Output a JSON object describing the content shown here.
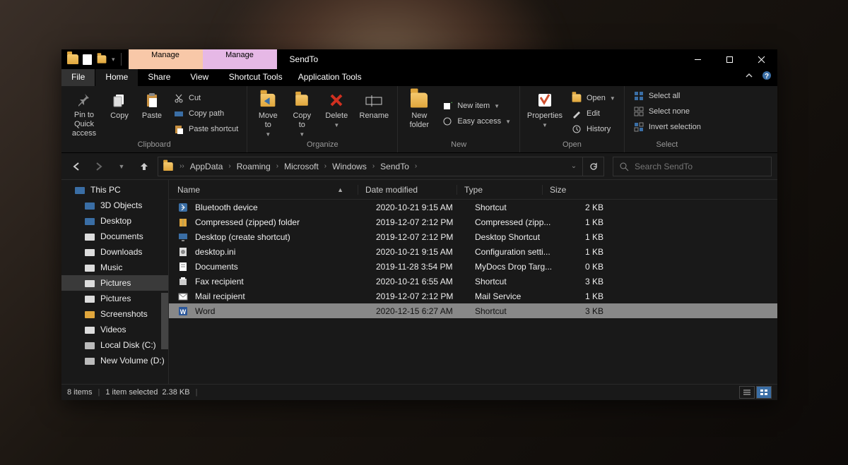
{
  "title": "SendTo",
  "contextual_tabs": [
    {
      "badge": "Manage",
      "tab": "Shortcut Tools"
    },
    {
      "badge": "Manage",
      "tab": "Application Tools"
    }
  ],
  "tabs": {
    "file": "File",
    "home": "Home",
    "share": "Share",
    "view": "View"
  },
  "ribbon": {
    "clipboard": {
      "label": "Clipboard",
      "pin": "Pin to Quick\naccess",
      "copy": "Copy",
      "paste": "Paste",
      "cut": "Cut",
      "copy_path": "Copy path",
      "paste_shortcut": "Paste shortcut"
    },
    "organize": {
      "label": "Organize",
      "move_to": "Move\nto",
      "copy_to": "Copy\nto",
      "delete": "Delete",
      "rename": "Rename"
    },
    "new": {
      "label": "New",
      "new_folder": "New\nfolder",
      "new_item": "New item",
      "easy_access": "Easy access"
    },
    "open": {
      "label": "Open",
      "properties": "Properties",
      "open": "Open",
      "edit": "Edit",
      "history": "History"
    },
    "select": {
      "label": "Select",
      "select_all": "Select all",
      "select_none": "Select none",
      "invert": "Invert selection"
    }
  },
  "breadcrumb": [
    "AppData",
    "Roaming",
    "Microsoft",
    "Windows",
    "SendTo"
  ],
  "search_placeholder": "Search SendTo",
  "columns": {
    "name": "Name",
    "date": "Date modified",
    "type": "Type",
    "size": "Size"
  },
  "nav": [
    {
      "label": "This PC",
      "depth": 1,
      "icon": "pc"
    },
    {
      "label": "3D Objects",
      "depth": 2,
      "icon": "3d"
    },
    {
      "label": "Desktop",
      "depth": 2,
      "icon": "desktop"
    },
    {
      "label": "Documents",
      "depth": 2,
      "icon": "docs"
    },
    {
      "label": "Downloads",
      "depth": 2,
      "icon": "downloads"
    },
    {
      "label": "Music",
      "depth": 2,
      "icon": "music"
    },
    {
      "label": "Pictures",
      "depth": 2,
      "icon": "pictures",
      "selected": true
    },
    {
      "label": "Pictures",
      "depth": 2,
      "icon": "pictures"
    },
    {
      "label": "Screenshots",
      "depth": 2,
      "icon": "folder"
    },
    {
      "label": "Videos",
      "depth": 2,
      "icon": "videos"
    },
    {
      "label": "Local Disk (C:)",
      "depth": 2,
      "icon": "disk"
    },
    {
      "label": "New Volume (D:)",
      "depth": 2,
      "icon": "disk"
    }
  ],
  "files": [
    {
      "name": "Bluetooth device",
      "date": "2020-10-21 9:15 AM",
      "type": "Shortcut",
      "size": "2 KB",
      "icon": "bt"
    },
    {
      "name": "Compressed (zipped) folder",
      "date": "2019-12-07 2:12 PM",
      "type": "Compressed (zipp...",
      "size": "1 KB",
      "icon": "zip"
    },
    {
      "name": "Desktop (create shortcut)",
      "date": "2019-12-07 2:12 PM",
      "type": "Desktop Shortcut",
      "size": "1 KB",
      "icon": "desktop"
    },
    {
      "name": "desktop.ini",
      "date": "2020-10-21 9:15 AM",
      "type": "Configuration setti...",
      "size": "1 KB",
      "icon": "ini"
    },
    {
      "name": "Documents",
      "date": "2019-11-28 3:54 PM",
      "type": "MyDocs Drop Targ...",
      "size": "0 KB",
      "icon": "docs"
    },
    {
      "name": "Fax recipient",
      "date": "2020-10-21 6:55 AM",
      "type": "Shortcut",
      "size": "3 KB",
      "icon": "fax"
    },
    {
      "name": "Mail recipient",
      "date": "2019-12-07 2:12 PM",
      "type": "Mail Service",
      "size": "1 KB",
      "icon": "mail"
    },
    {
      "name": "Word",
      "date": "2020-12-15 6:27 AM",
      "type": "Shortcut",
      "size": "3 KB",
      "icon": "word",
      "selected": true
    }
  ],
  "status": {
    "items": "8 items",
    "selected": "1 item selected",
    "size": "2.38 KB"
  }
}
